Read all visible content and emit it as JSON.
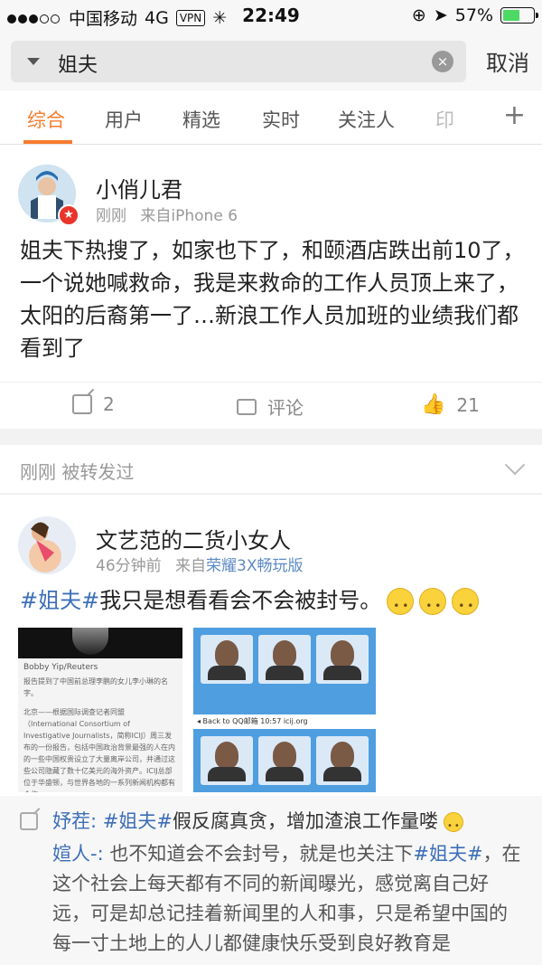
{
  "status_bar": {
    "carrier": "中国移动",
    "network": "4G",
    "vpn": "VPN",
    "time": "22:49",
    "battery_pct": "57%",
    "battery_level": 0.57
  },
  "search": {
    "query": "姐夫",
    "clear": "×",
    "cancel": "取消"
  },
  "tabs": [
    "综合",
    "用户",
    "精选",
    "实时",
    "关注人",
    "印"
  ],
  "tabs_more": "+",
  "post1": {
    "username": "小俏儿君",
    "time": "刚刚",
    "source_prefix": "来自",
    "source": "iPhone 6",
    "badge": "★",
    "text": "姐夫下热搜了，如家也下了，和颐酒店跌出前10了，一个说她喊救命，我是来救命的工作人员顶上来了，太阳的后裔第一了…新浪工作人员加班的业绩我们都看到了",
    "reposts": "2",
    "comments": "评论",
    "likes": "21"
  },
  "repost_notice": "刚刚 被转发过",
  "post2": {
    "username": "文艺范的二货小女人",
    "time": "46分钟前",
    "source_prefix": "来自",
    "source": "荣耀3X畅玩版",
    "hashtag": "#姐夫#",
    "text": "我只是想看看会不会被封号。",
    "image1": {
      "credit": "Bobby Yip/Reuters",
      "caption": "报告提到了中国前总理李鹏的女儿李小琳的名字。",
      "body": "北京——根据国际调查记者同盟（International Consortium of Investigative Journalists，简称ICIJ）周三发布的一份报告，包括中国政治背景最强的人在内的一些中国权贵设立了大量离岸公司，并通过这些公司隐藏了数十亿美元的海外资产。ICIJ总部位于华盛顿，与世界各地的一系列新闻机构都有合作。"
    },
    "image2": {
      "status": "◂ Back to QQ邮箱   10:57   icij.org"
    },
    "comment1": {
      "name": "妤茬:",
      "hashtag": "#姐夫#",
      "text": "假反腐真贪，增加渣浪工作量喽"
    },
    "comment2": {
      "name": "媗人-:",
      "text_a": "也不知道会不会封号，就是也关注下",
      "hashtag": "#姐夫#",
      "text_b": "，在这个社会上每天都有不同的新闻曝光，感觉离自己好远，可是却总记挂着新闻里的人和事，只是希望中国的每一寸土地上的人儿都健康快乐受到良好教育是"
    }
  },
  "colors": {
    "accent": "#f77c2e",
    "link": "#3d6fb8",
    "verified": "#e8342a"
  }
}
